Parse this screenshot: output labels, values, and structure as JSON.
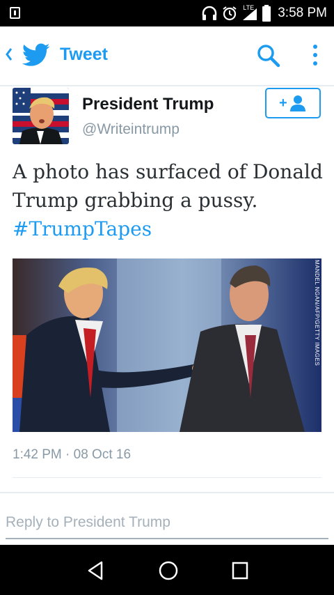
{
  "status_bar": {
    "time": "3:58 PM",
    "network_label": "LTE",
    "icons": [
      "sim-icon",
      "headphones-icon",
      "alarm-icon",
      "signal-icon",
      "battery-icon"
    ]
  },
  "app_bar": {
    "back_icon": "chevron-left-icon",
    "logo_icon": "twitter-bird-icon",
    "title": "Tweet",
    "search_icon": "search-icon",
    "more_icon": "more-vertical-icon"
  },
  "tweet": {
    "display_name": "President Trump",
    "handle": "@Writeintrump",
    "follow_icon": "follow-user-icon",
    "follow_label": "+",
    "text_part1": "A photo has surfaced of Donald Trump grabbing a pussy.",
    "hashtag": "#TrumpTapes",
    "photo_credit": "MANDEL NGAN/AFP/GETTY IMAGES",
    "timestamp": "1:42 PM · 08 Oct 16"
  },
  "reply": {
    "placeholder": "Reply to President Trump"
  },
  "nav_bar": {
    "icons": [
      "back-triangle-icon",
      "home-circle-icon",
      "recent-apps-icon"
    ]
  },
  "colors": {
    "accent": "#1d9bf0",
    "text": "#292f33",
    "muted": "#8899a6",
    "divider": "#e6ecf0"
  }
}
